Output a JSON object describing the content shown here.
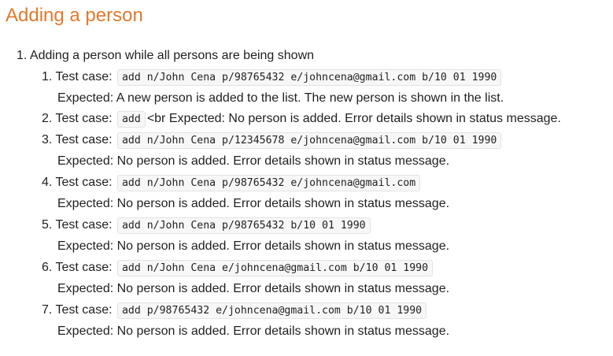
{
  "section_title": "Adding a person",
  "outer_item": "1. Adding a person while all persons are being shown",
  "test_case_label": "Test case:",
  "test_cases": [
    {
      "number": "1.",
      "command": "add n/John Cena p/98765432 e/johncena@gmail.com b/10 01 1990",
      "expected": "Expected: A new person is added to the list. The new person is shown in the list."
    },
    {
      "number": "2.",
      "command": "add",
      "trailing": "<br Expected: No person is added. Error details shown in status message."
    },
    {
      "number": "3.",
      "command": "add n/John Cena p/12345678 e/johncena@gmail.com b/10 01 1990",
      "expected": "Expected: No person is added. Error details shown in status message."
    },
    {
      "number": "4.",
      "command": "add n/John Cena p/98765432 e/johncena@gmail.com",
      "expected": "Expected: No person is added. Error details shown in status message."
    },
    {
      "number": "5.",
      "command": "add n/John Cena p/98765432 b/10 01 1990",
      "expected": "Expected: No person is added. Error details shown in status message."
    },
    {
      "number": "6.",
      "command": "add n/John Cena e/johncena@gmail.com b/10 01 1990",
      "expected": "Expected: No person is added. Error details shown in status message."
    },
    {
      "number": "7.",
      "command": "add p/98765432 e/johncena@gmail.com b/10 01 1990",
      "expected": "Expected: No person is added. Error details shown in status message."
    }
  ]
}
